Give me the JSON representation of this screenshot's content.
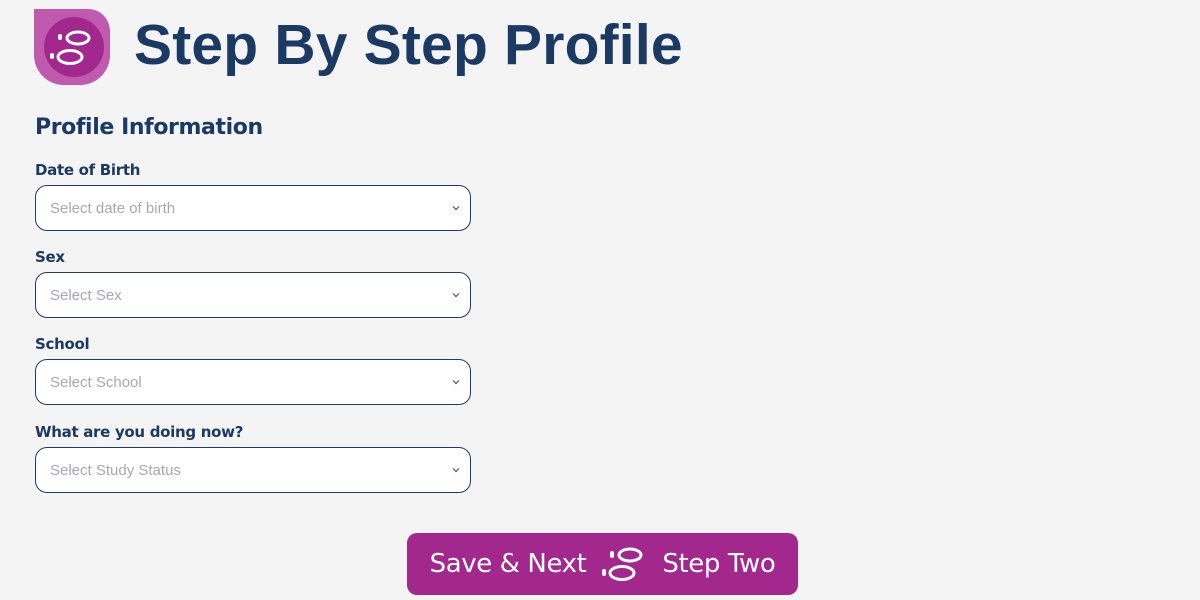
{
  "header": {
    "title": "Step By Step Profile",
    "logo_icon": "footsteps-logo-icon"
  },
  "form": {
    "section_title": "Profile Information",
    "fields": [
      {
        "label": "Date of Birth",
        "placeholder": "Select date of birth"
      },
      {
        "label": "Sex",
        "placeholder": "Select Sex"
      },
      {
        "label": "School",
        "placeholder": "Select School"
      },
      {
        "label": "What are you doing now?",
        "placeholder": "Select Study Status"
      }
    ]
  },
  "cta": {
    "left_text": "Save & Next",
    "right_text": "Step Two",
    "icon": "footsteps-icon"
  },
  "colors": {
    "background": "#f5f4f5",
    "title": "#1b3a63",
    "brand_purple": "#a3288e",
    "logo_light": "#c05aae",
    "border": "#1f3a66",
    "placeholder": "#a9a9ae"
  }
}
